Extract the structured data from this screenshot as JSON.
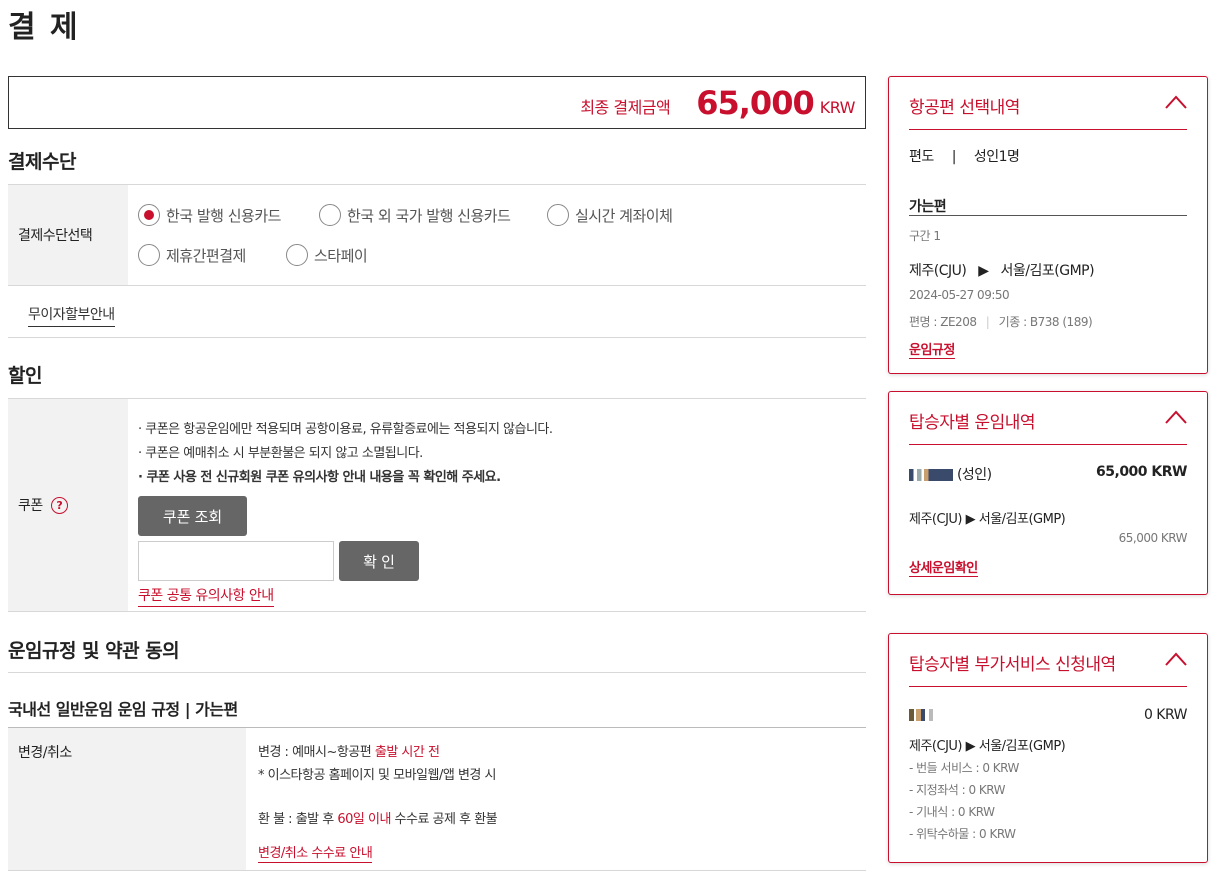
{
  "page": {
    "title": "결 제"
  },
  "total": {
    "label": "최종 결제금액",
    "amount": "65,000",
    "currency": "KRW"
  },
  "payment": {
    "title": "결제수단",
    "select_label": "결제수단선택",
    "options": [
      "한국 발행 신용카드",
      "한국 외 국가 발행 신용카드",
      "실시간 계좌이체",
      "제휴간편결제",
      "스타페이"
    ],
    "selected": 0,
    "installment_link": "무이자할부안내"
  },
  "discount": {
    "title": "할인",
    "coupon_label": "쿠폰",
    "notes": [
      "· 쿠폰은 항공운임에만 적용되며 공항이용료, 유류할증료에는 적용되지 않습니다.",
      "· 쿠폰은 예매취소 시 부분환불은 되지 않고 소멸됩니다.",
      "· 쿠폰 사용 전 신규회원 쿠폰 유의사항 안내 내용을 꼭 확인해 주세요."
    ],
    "lookup_button": "쿠폰 조회",
    "confirm_button": "확 인",
    "notice_link": "쿠폰 공통 유의사항 안내"
  },
  "terms": {
    "title": "운임규정 및 약관 동의",
    "subtitle": "국내선 일반운임 운임 규정 | 가는편",
    "change_label": "변경/취소",
    "line1_prefix": "변경 : 예매시~항공편 ",
    "line1_red": "출발 시간 전",
    "line2": "* 이스타항공 홈페이지 및 모바일웹/앱 변경 시",
    "line3_prefix": "환 불 : 출발 후 ",
    "line3_red": "60일 이내",
    "line3_suffix": " 수수료 공제 후 환불",
    "fee_link": "변경/취소 수수료 안내"
  },
  "flight_panel": {
    "title": "항공편 선택내역",
    "trip_type": "편도",
    "sep": "|",
    "pax": "성인1명",
    "outbound_label": "가는편",
    "segment": "구간 1",
    "from": "제주(CJU)",
    "arrow": "▶",
    "to": "서울/김포(GMP)",
    "datetime": "2024-05-27 09:50",
    "flight_no": "편명 : ZE208",
    "aircraft": "기종 : B738 (189)",
    "fare_rule_link": "운임규정"
  },
  "fare_panel": {
    "title": "탑승자별 운임내역",
    "pax_suffix": "(성인)",
    "pax_total": "65,000 KRW",
    "route": "제주(CJU)  ▶  서울/김포(GMP)",
    "route_amount": "65,000 KRW",
    "detail_link": "상세운임확인"
  },
  "service_panel": {
    "title": "탑승자별 부가서비스 신청내역",
    "total": "0 KRW",
    "route": "제주(CJU)  ▶  서울/김포(GMP)",
    "items": [
      "- 번들 서비스 : 0 KRW",
      "- 지정좌석 : 0 KRW",
      "- 기내식 : 0 KRW",
      "- 위탁수하물 : 0 KRW"
    ]
  },
  "colors": {
    "accent": "#c8102e",
    "button_dark": "#666666",
    "side_bg": "#f2f2f2"
  }
}
